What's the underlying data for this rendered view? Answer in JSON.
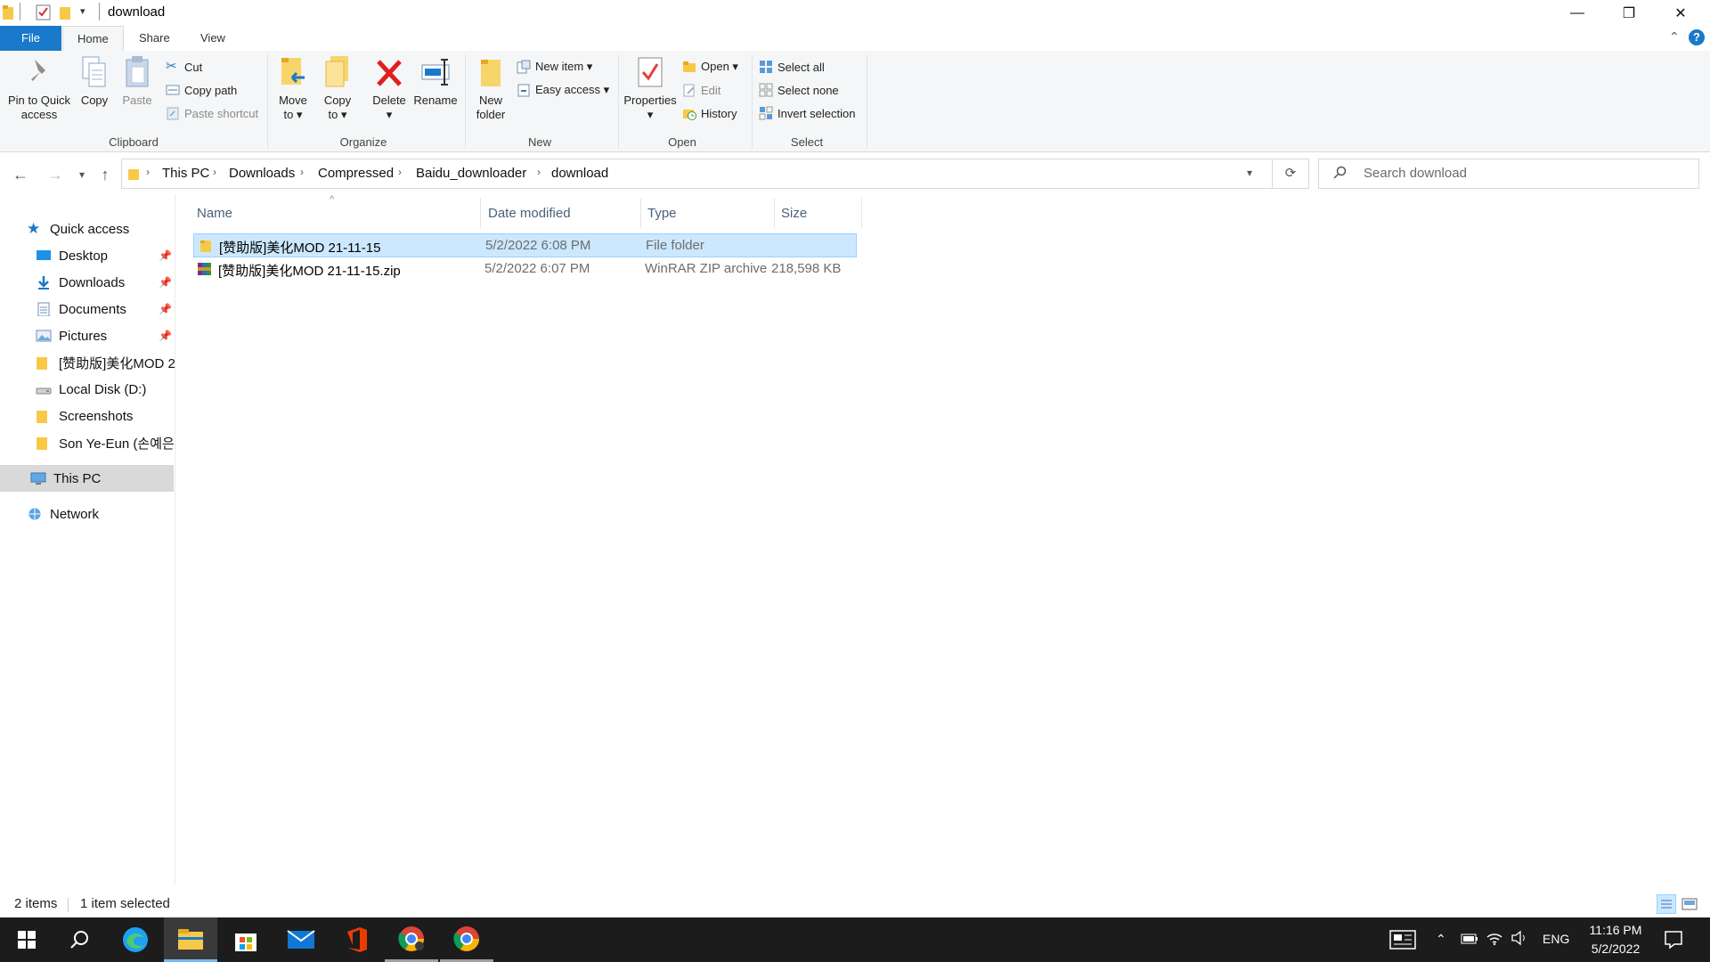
{
  "window": {
    "title": "download",
    "controls": {
      "minimize": "—",
      "restore": "❐",
      "close": "✕"
    }
  },
  "ribbon_tabs": [
    "File",
    "Home",
    "Share",
    "View"
  ],
  "ribbon": {
    "clipboard": {
      "pin_label_1": "Pin to Quick",
      "pin_label_2": "access",
      "copy": "Copy",
      "paste": "Paste",
      "cut": "Cut",
      "copy_path": "Copy path",
      "paste_shortcut": "Paste shortcut",
      "group": "Clipboard"
    },
    "organize": {
      "move_1": "Move",
      "move_2": "to ▾",
      "copyto_1": "Copy",
      "copyto_2": "to ▾",
      "delete": "Delete",
      "delete_arrow": "▾",
      "rename": "Rename",
      "group": "Organize"
    },
    "new": {
      "new_folder_1": "New",
      "new_folder_2": "folder",
      "new_item": "New item ▾",
      "easy_access": "Easy access ▾",
      "group": "New"
    },
    "open": {
      "properties": "Properties",
      "properties_arrow": "▾",
      "open": "Open ▾",
      "edit": "Edit",
      "history": "History",
      "group": "Open"
    },
    "select": {
      "select_all": "Select all",
      "select_none": "Select none",
      "invert": "Invert selection",
      "group": "Select"
    }
  },
  "address": {
    "crumbs": [
      "This PC",
      "Downloads",
      "Compressed",
      "Baidu_downloader",
      "download"
    ],
    "search_placeholder": "Search download"
  },
  "nav": {
    "quick_access": "Quick access",
    "items": [
      {
        "label": "Desktop",
        "pinned": true
      },
      {
        "label": "Downloads",
        "pinned": true
      },
      {
        "label": "Documents",
        "pinned": true
      },
      {
        "label": "Pictures",
        "pinned": true
      },
      {
        "label": "[赞助版]美化MOD 2",
        "pinned": false
      },
      {
        "label": "Local Disk (D:)",
        "pinned": false
      },
      {
        "label": "Screenshots",
        "pinned": false
      },
      {
        "label": "Son Ye-Eun (손예은)",
        "pinned": false
      }
    ],
    "this_pc": "This PC",
    "network": "Network"
  },
  "columns": {
    "name": "Name",
    "date": "Date modified",
    "type": "Type",
    "size": "Size"
  },
  "files": [
    {
      "name": "[赞助版]美化MOD 21-11-15",
      "date": "5/2/2022 6:08 PM",
      "type": "File folder",
      "size": "",
      "selected": true
    },
    {
      "name": "[赞助版]美化MOD 21-11-15.zip",
      "date": "5/2/2022 6:07 PM",
      "type": "WinRAR ZIP archive",
      "size": "218,598 KB",
      "selected": false
    }
  ],
  "status": {
    "count": "2 items",
    "selected": "1 item selected"
  },
  "taskbar": {
    "clock_time": "11:16 PM",
    "clock_date": "5/2/2022",
    "language": "ENG"
  },
  "colors": {
    "accent": "#1979ca",
    "selection": "#cce8ff",
    "taskbar": "#1c1c1c"
  }
}
